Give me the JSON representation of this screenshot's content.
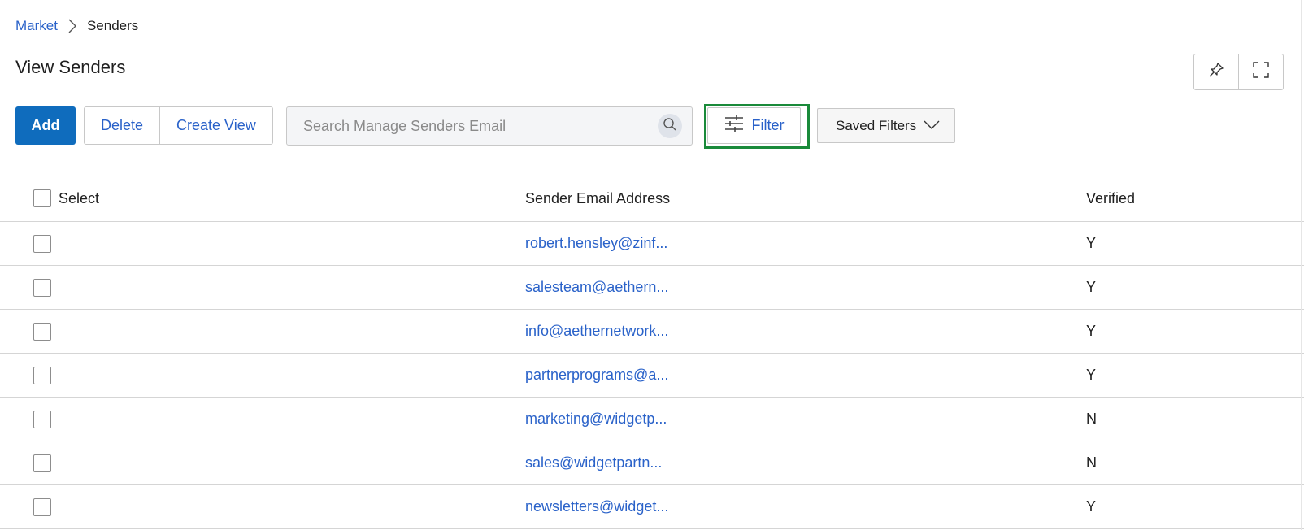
{
  "breadcrumb": {
    "parent": "Market",
    "current": "Senders"
  },
  "page": {
    "title": "View Senders"
  },
  "toolbar": {
    "add_label": "Add",
    "delete_label": "Delete",
    "create_view_label": "Create View",
    "filter_label": "Filter",
    "saved_filters_label": "Saved Filters"
  },
  "search": {
    "placeholder": "Search Manage Senders Email",
    "value": ""
  },
  "table": {
    "columns": {
      "select": "Select",
      "email": "Sender Email Address",
      "verified": "Verified"
    },
    "rows": [
      {
        "email": "robert.hensley@zinf...",
        "verified": "Y"
      },
      {
        "email": "salesteam@aethern...",
        "verified": "Y"
      },
      {
        "email": "info@aethernetwork...",
        "verified": "Y"
      },
      {
        "email": "partnerprograms@a...",
        "verified": "Y"
      },
      {
        "email": "marketing@widgetp...",
        "verified": "N"
      },
      {
        "email": "sales@widgetpartn...",
        "verified": "N"
      },
      {
        "email": "newsletters@widget...",
        "verified": "Y"
      }
    ]
  },
  "icons": {
    "breadcrumb_separator": "chevron-right-icon",
    "pin": "pin-icon",
    "fullscreen": "fullscreen-icon",
    "search": "search-icon",
    "filter": "sliders-icon",
    "dropdown": "chevron-down-icon"
  },
  "colors": {
    "accent": "#0f6cbd",
    "link": "#2a62c9",
    "highlight": "#1a8a3a"
  }
}
